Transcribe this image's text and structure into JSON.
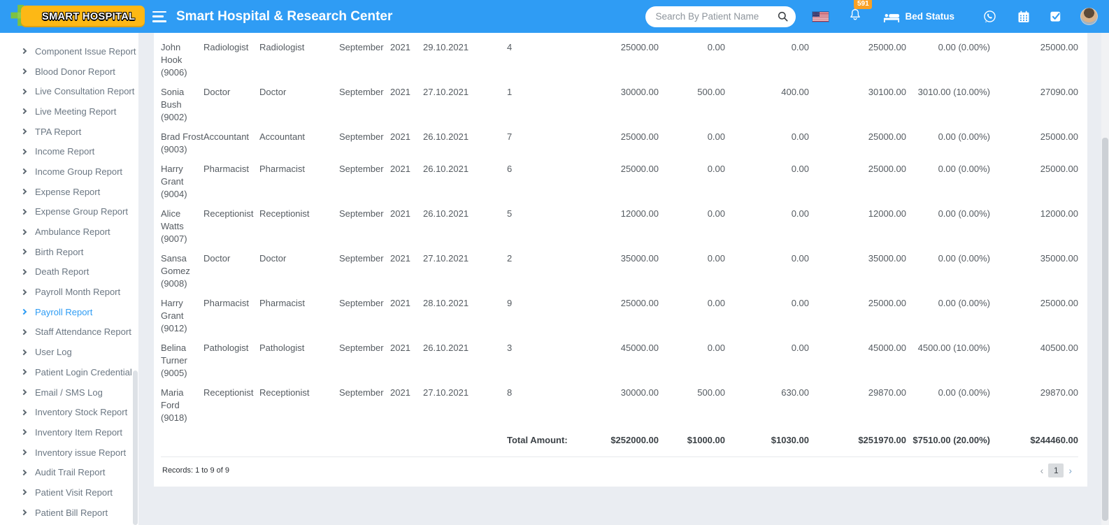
{
  "colors": {
    "navbar_blue": "#2F9CF4",
    "badge_orange": "#F9A124",
    "logo_yellow": "#FDB815",
    "active_blue": "#2E9CF4",
    "logo_green": "#7DC242",
    "logo_pink": "#E91E63"
  },
  "header": {
    "logo_text": "SMART HOSPITAL",
    "title": "Smart Hospital & Research Center",
    "search_placeholder": "Search By Patient Name",
    "notification_count": "591",
    "bed_status_label": "Bed Status"
  },
  "sidebar": {
    "items": [
      {
        "label": "Component Issue Report",
        "active": false
      },
      {
        "label": "Blood Donor Report",
        "active": false
      },
      {
        "label": "Live Consultation Report",
        "active": false
      },
      {
        "label": "Live Meeting Report",
        "active": false
      },
      {
        "label": "TPA Report",
        "active": false
      },
      {
        "label": "Income Report",
        "active": false
      },
      {
        "label": "Income Group Report",
        "active": false
      },
      {
        "label": "Expense Report",
        "active": false
      },
      {
        "label": "Expense Group Report",
        "active": false
      },
      {
        "label": "Ambulance Report",
        "active": false
      },
      {
        "label": "Birth Report",
        "active": false
      },
      {
        "label": "Death Report",
        "active": false
      },
      {
        "label": "Payroll Month Report",
        "active": false
      },
      {
        "label": "Payroll Report",
        "active": true
      },
      {
        "label": "Staff Attendance Report",
        "active": false
      },
      {
        "label": "User Log",
        "active": false
      },
      {
        "label": "Patient Login Credential",
        "active": false
      },
      {
        "label": "Email / SMS Log",
        "active": false
      },
      {
        "label": "Inventory Stock Report",
        "active": false
      },
      {
        "label": "Inventory Item Report",
        "active": false
      },
      {
        "label": "Inventory issue Report",
        "active": false
      },
      {
        "label": "Audit Trail Report",
        "active": false
      },
      {
        "label": "Patient Visit Report",
        "active": false
      },
      {
        "label": "Patient Bill Report",
        "active": false
      }
    ]
  },
  "table": {
    "rows": [
      {
        "name": "John Hook (9006)",
        "role": "Radiologist",
        "designation": "Radiologist",
        "month": "September",
        "year": "2021",
        "date": "29.10.2021",
        "payslip_no": "4",
        "basic_salary": "25000.00",
        "earning": "0.00",
        "deduction": "0.00",
        "gross_salary": "25000.00",
        "tax": "0.00 (0.00%)",
        "net_salary": "25000.00"
      },
      {
        "name": "Sonia Bush (9002)",
        "role": "Doctor",
        "designation": "Doctor",
        "month": "September",
        "year": "2021",
        "date": "27.10.2021",
        "payslip_no": "1",
        "basic_salary": "30000.00",
        "earning": "500.00",
        "deduction": "400.00",
        "gross_salary": "30100.00",
        "tax": "3010.00 (10.00%)",
        "net_salary": "27090.00"
      },
      {
        "name": "Brad Frost (9003)",
        "role": "Accountant",
        "designation": "Accountant",
        "month": "September",
        "year": "2021",
        "date": "26.10.2021",
        "payslip_no": "7",
        "basic_salary": "25000.00",
        "earning": "0.00",
        "deduction": "0.00",
        "gross_salary": "25000.00",
        "tax": "0.00 (0.00%)",
        "net_salary": "25000.00"
      },
      {
        "name": "Harry Grant (9004)",
        "role": "Pharmacist",
        "designation": "Pharmacist",
        "month": "September",
        "year": "2021",
        "date": "26.10.2021",
        "payslip_no": "6",
        "basic_salary": "25000.00",
        "earning": "0.00",
        "deduction": "0.00",
        "gross_salary": "25000.00",
        "tax": "0.00 (0.00%)",
        "net_salary": "25000.00"
      },
      {
        "name": "Alice Watts (9007)",
        "role": "Receptionist",
        "designation": "Receptionist",
        "month": "September",
        "year": "2021",
        "date": "26.10.2021",
        "payslip_no": "5",
        "basic_salary": "12000.00",
        "earning": "0.00",
        "deduction": "0.00",
        "gross_salary": "12000.00",
        "tax": "0.00 (0.00%)",
        "net_salary": "12000.00"
      },
      {
        "name": "Sansa Gomez (9008)",
        "role": "Doctor",
        "designation": "Doctor",
        "month": "September",
        "year": "2021",
        "date": "27.10.2021",
        "payslip_no": "2",
        "basic_salary": "35000.00",
        "earning": "0.00",
        "deduction": "0.00",
        "gross_salary": "35000.00",
        "tax": "0.00 (0.00%)",
        "net_salary": "35000.00"
      },
      {
        "name": "Harry Grant (9012)",
        "role": "Pharmacist",
        "designation": "Pharmacist",
        "month": "September",
        "year": "2021",
        "date": "28.10.2021",
        "payslip_no": "9",
        "basic_salary": "25000.00",
        "earning": "0.00",
        "deduction": "0.00",
        "gross_salary": "25000.00",
        "tax": "0.00 (0.00%)",
        "net_salary": "25000.00"
      },
      {
        "name": "Belina Turner (9005)",
        "role": "Pathologist",
        "designation": "Pathologist",
        "month": "September",
        "year": "2021",
        "date": "26.10.2021",
        "payslip_no": "3",
        "basic_salary": "45000.00",
        "earning": "0.00",
        "deduction": "0.00",
        "gross_salary": "45000.00",
        "tax": "4500.00 (10.00%)",
        "net_salary": "40500.00"
      },
      {
        "name": "Maria Ford (9018)",
        "role": "Receptionist",
        "designation": "Receptionist",
        "month": "September",
        "year": "2021",
        "date": "27.10.2021",
        "payslip_no": "8",
        "basic_salary": "30000.00",
        "earning": "500.00",
        "deduction": "630.00",
        "gross_salary": "29870.00",
        "tax": "0.00 (0.00%)",
        "net_salary": "29870.00"
      }
    ],
    "total": {
      "label": "Total Amount:",
      "basic_salary": "$252000.00",
      "earning": "$1000.00",
      "deduction": "$1030.00",
      "gross_salary": "$251970.00",
      "tax": "$7510.00 (20.00%)",
      "net_salary": "$244460.00"
    },
    "records_text": "Records: 1 to 9 of 9",
    "pagination": {
      "prev": "‹",
      "page": "1",
      "next": "›"
    }
  }
}
